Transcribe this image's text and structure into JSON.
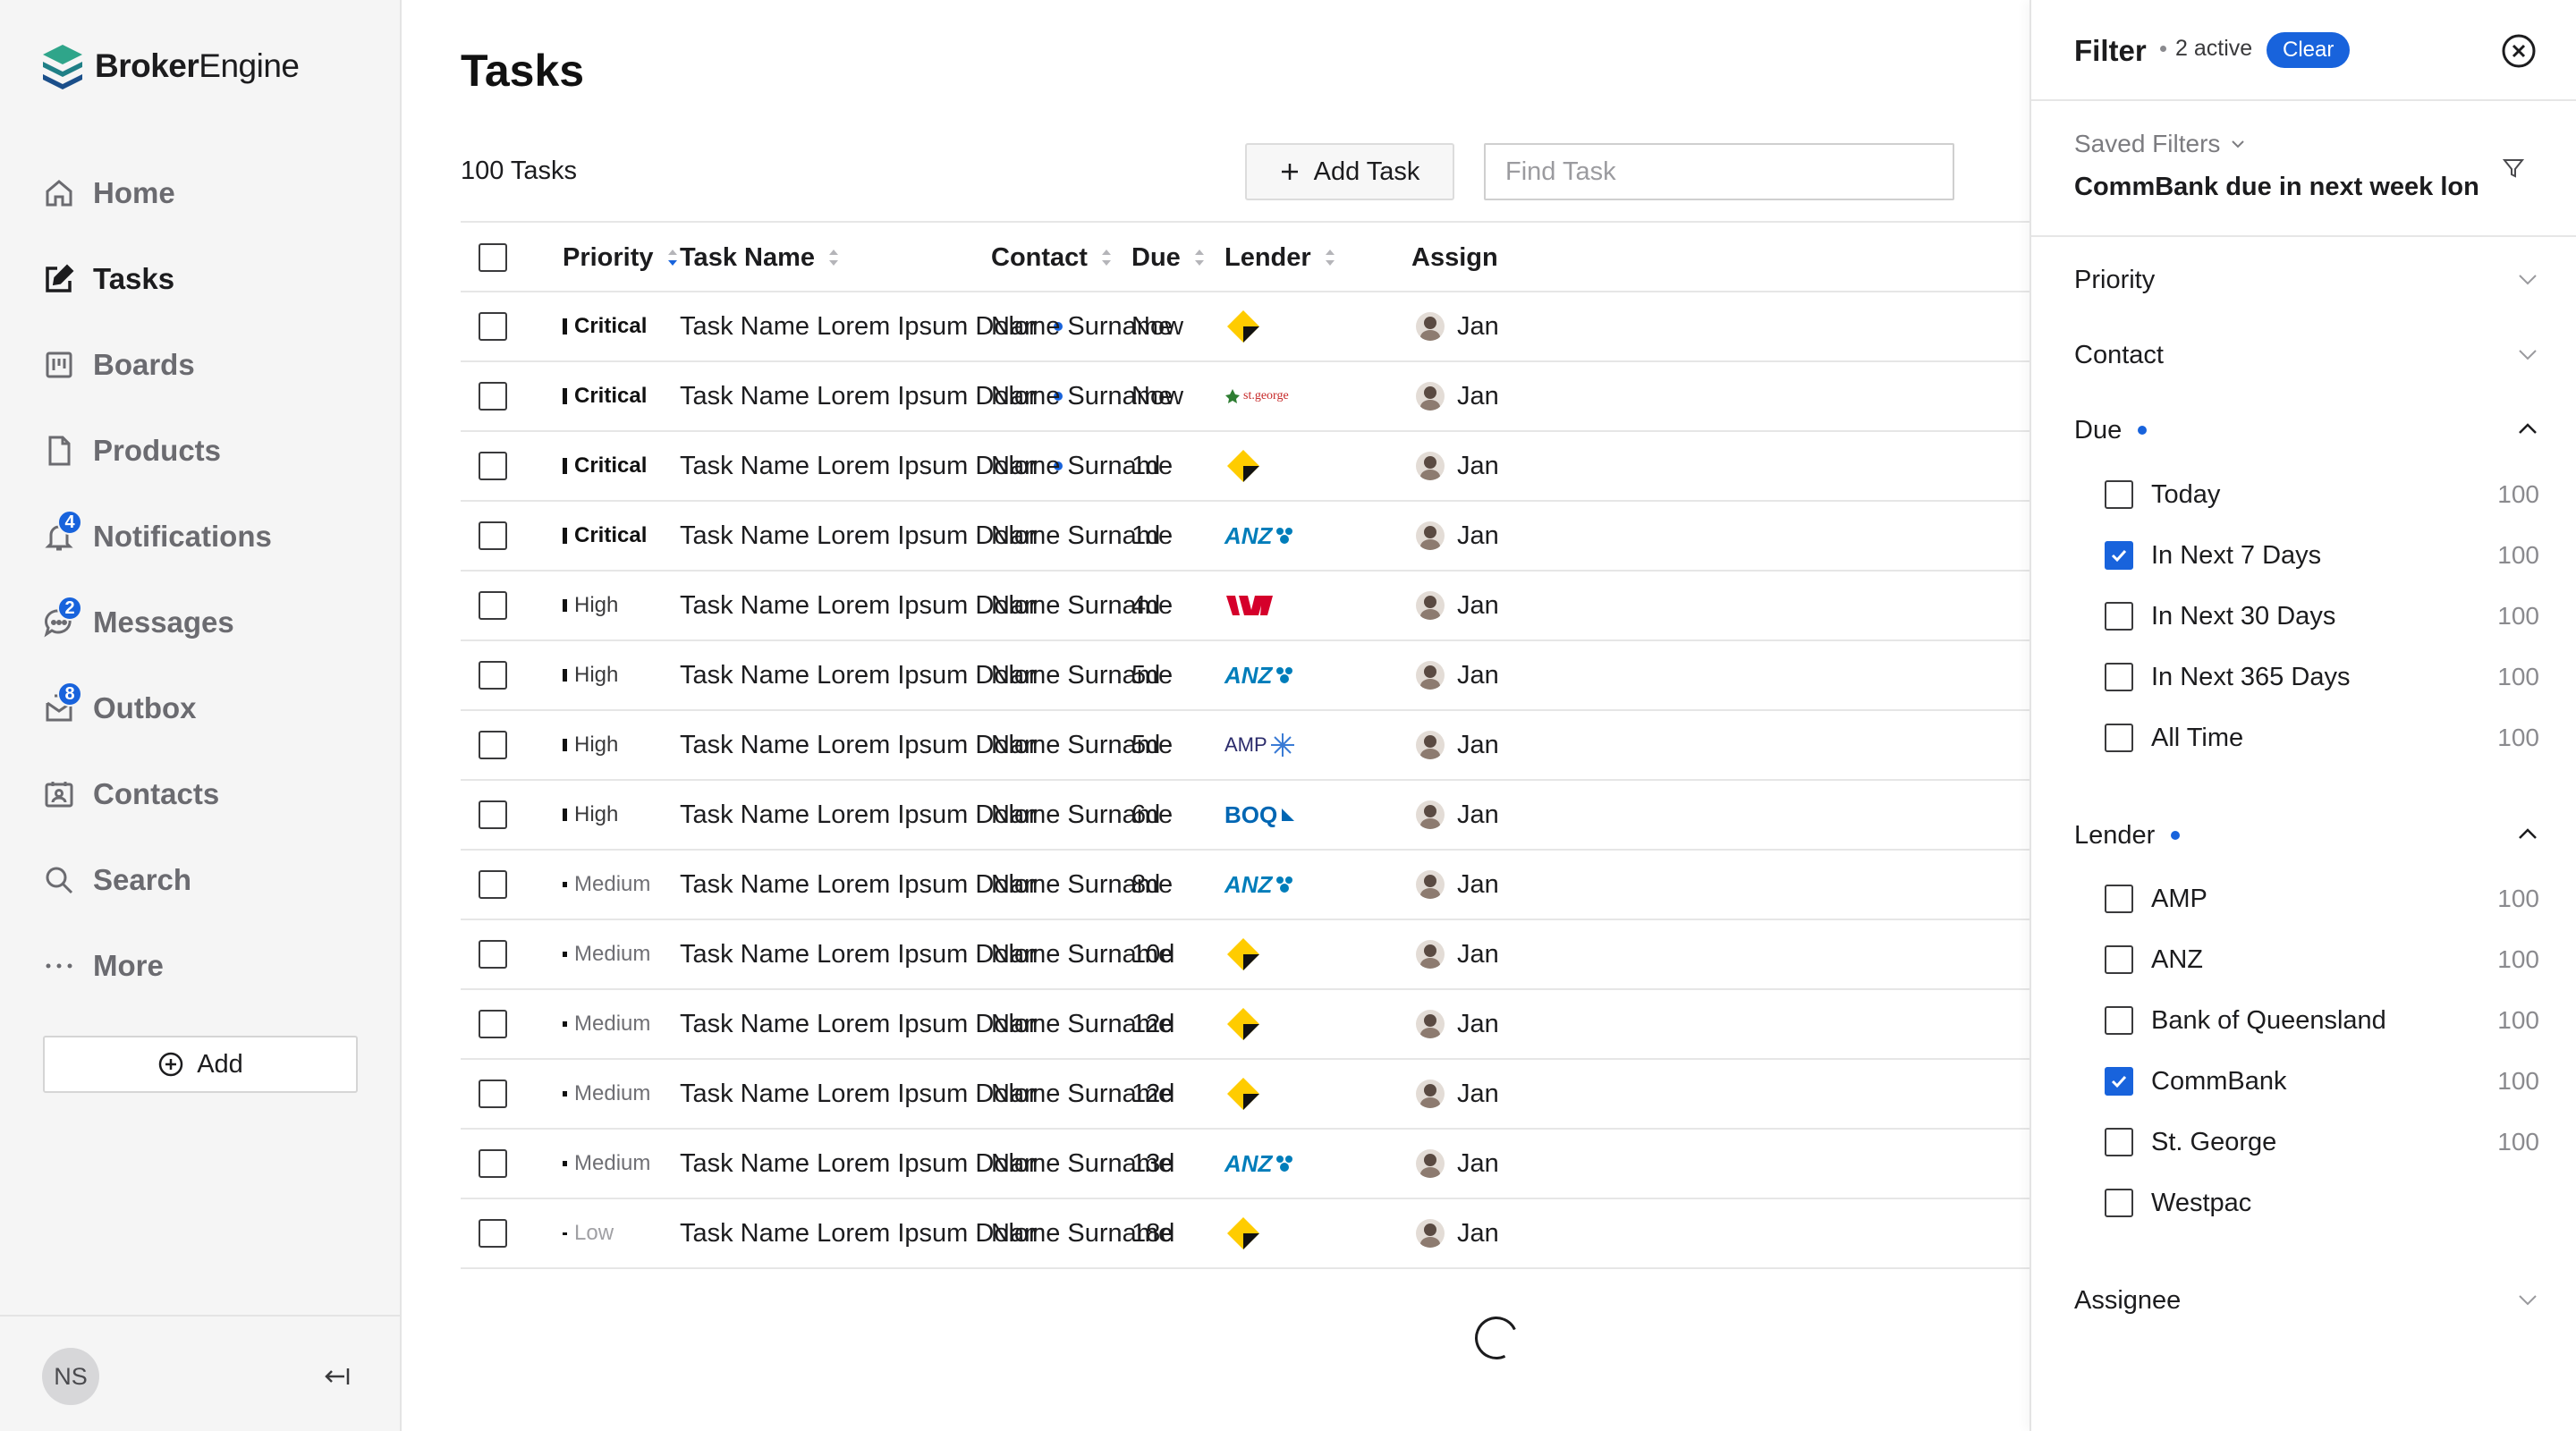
{
  "app": {
    "brand_bold": "Broker",
    "brand_regular": "Engine"
  },
  "nav": [
    {
      "id": "home",
      "label": "Home",
      "icon": "home-icon",
      "active": false,
      "badge": ""
    },
    {
      "id": "tasks",
      "label": "Tasks",
      "icon": "edit-icon",
      "active": true,
      "badge": ""
    },
    {
      "id": "boards",
      "label": "Boards",
      "icon": "board-icon",
      "active": false,
      "badge": ""
    },
    {
      "id": "products",
      "label": "Products",
      "icon": "document-icon",
      "active": false,
      "badge": ""
    },
    {
      "id": "notifications",
      "label": "Notifications",
      "icon": "bell-icon",
      "active": false,
      "badge": "4"
    },
    {
      "id": "messages",
      "label": "Messages",
      "icon": "chat-icon",
      "active": false,
      "badge": "2"
    },
    {
      "id": "outbox",
      "label": "Outbox",
      "icon": "outbox-icon",
      "active": false,
      "badge": "8"
    },
    {
      "id": "contacts",
      "label": "Contacts",
      "icon": "contacts-icon",
      "active": false,
      "badge": ""
    },
    {
      "id": "search",
      "label": "Search",
      "icon": "search-icon",
      "active": false,
      "badge": ""
    },
    {
      "id": "more",
      "label": "More",
      "icon": "more-icon",
      "active": false,
      "badge": ""
    }
  ],
  "sidebar": {
    "add_label": "Add",
    "user_initials": "NS"
  },
  "main": {
    "title": "Tasks",
    "task_count": "100 Tasks",
    "add_task_label": "Add Task",
    "search_placeholder": "Find Task"
  },
  "table": {
    "columns": [
      "Priority",
      "Task Name",
      "Contact",
      "Due",
      "Lender",
      "Assign"
    ],
    "rows": [
      {
        "priority": "Critical",
        "level": "critical",
        "task": "Task Name Lorem Ipsum Dolor",
        "unread": true,
        "contact": "Name Surname",
        "due": "Now",
        "lender": "commbank",
        "assignee": "Jan"
      },
      {
        "priority": "Critical",
        "level": "critical",
        "task": "Task Name Lorem Ipsum Dolor",
        "unread": true,
        "contact": "Name Surname",
        "due": "Now",
        "lender": "stgeorge",
        "assignee": "Jan"
      },
      {
        "priority": "Critical",
        "level": "critical",
        "task": "Task Name Lorem Ipsum Dolor",
        "unread": true,
        "contact": "Name Surname",
        "due": "1d",
        "lender": "commbank",
        "assignee": "Jan"
      },
      {
        "priority": "Critical",
        "level": "critical",
        "task": "Task Name Lorem Ipsum Dolor",
        "unread": false,
        "contact": "Name Surname",
        "due": "1d",
        "lender": "anz",
        "assignee": "Jan"
      },
      {
        "priority": "High",
        "level": "high",
        "task": "Task Name Lorem Ipsum Dolor",
        "unread": false,
        "contact": "Name Surname",
        "due": "4d",
        "lender": "westpac",
        "assignee": "Jan"
      },
      {
        "priority": "High",
        "level": "high",
        "task": "Task Name Lorem Ipsum Dolor",
        "unread": false,
        "contact": "Name Surname",
        "due": "5d",
        "lender": "anz",
        "assignee": "Jan"
      },
      {
        "priority": "High",
        "level": "high",
        "task": "Task Name Lorem Ipsum Dolor",
        "unread": false,
        "contact": "Name Surname",
        "due": "5d",
        "lender": "amp",
        "assignee": "Jan"
      },
      {
        "priority": "High",
        "level": "high",
        "task": "Task Name Lorem Ipsum Dolor",
        "unread": false,
        "contact": "Name Surname",
        "due": "6d",
        "lender": "boq",
        "assignee": "Jan"
      },
      {
        "priority": "Medium",
        "level": "medium",
        "task": "Task Name Lorem Ipsum Dolor",
        "unread": false,
        "contact": "Name Surname",
        "due": "8d",
        "lender": "anz",
        "assignee": "Jan"
      },
      {
        "priority": "Medium",
        "level": "medium",
        "task": "Task Name Lorem Ipsum Dolor",
        "unread": false,
        "contact": "Name Surname",
        "due": "10d",
        "lender": "commbank",
        "assignee": "Jan"
      },
      {
        "priority": "Medium",
        "level": "medium",
        "task": "Task Name Lorem Ipsum Dolor",
        "unread": false,
        "contact": "Name Surname",
        "due": "12d",
        "lender": "commbank",
        "assignee": "Jan"
      },
      {
        "priority": "Medium",
        "level": "medium",
        "task": "Task Name Lorem Ipsum Dolor",
        "unread": false,
        "contact": "Name Surname",
        "due": "12d",
        "lender": "commbank",
        "assignee": "Jan"
      },
      {
        "priority": "Medium",
        "level": "medium",
        "task": "Task Name Lorem Ipsum Dolor",
        "unread": false,
        "contact": "Name Surname",
        "due": "13d",
        "lender": "anz",
        "assignee": "Jan"
      },
      {
        "priority": "Low",
        "level": "low",
        "task": "Task Name Lorem Ipsum Dolor",
        "unread": false,
        "contact": "Name Surname",
        "due": "18d",
        "lender": "commbank",
        "assignee": "Jan"
      }
    ]
  },
  "lender_marks": {
    "stgeorge": "st.george",
    "anz": "ANZ",
    "amp": "AMP",
    "boq": "BOQ"
  },
  "filter": {
    "title": "Filter",
    "active_text": "2 active",
    "clear_label": "Clear",
    "saved_label": "Saved Filters",
    "saved_value": "CommBank due in next week lon",
    "sections": {
      "priority": "Priority",
      "contact": "Contact",
      "due": "Due",
      "lender": "Lender",
      "assignee": "Assignee"
    },
    "due_options": [
      {
        "label": "Today",
        "count": "100",
        "checked": false
      },
      {
        "label": "In Next 7 Days",
        "count": "100",
        "checked": true
      },
      {
        "label": "In Next 30 Days",
        "count": "100",
        "checked": false
      },
      {
        "label": "In Next 365 Days",
        "count": "100",
        "checked": false
      },
      {
        "label": "All Time",
        "count": "100",
        "checked": false
      }
    ],
    "lender_options": [
      {
        "label": "AMP",
        "count": "100",
        "checked": false
      },
      {
        "label": "ANZ",
        "count": "100",
        "checked": false
      },
      {
        "label": "Bank of Queensland",
        "count": "100",
        "checked": false
      },
      {
        "label": "CommBank",
        "count": "100",
        "checked": true
      },
      {
        "label": "St. George",
        "count": "100",
        "checked": false
      },
      {
        "label": "Westpac",
        "count": "",
        "checked": false
      }
    ]
  },
  "colors": {
    "accent": "#1863dc",
    "commbank_yellow": "#ffcc00",
    "westpac_red": "#d5002b",
    "anz_blue": "#007dba",
    "boq_blue": "#0066b3"
  }
}
